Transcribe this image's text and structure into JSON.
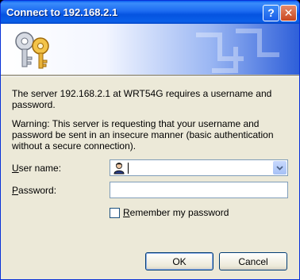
{
  "window": {
    "title": "Connect to 192.168.2.1",
    "help_label": "?",
    "close_label": "✕"
  },
  "messages": {
    "info": "The server 192.168.2.1 at WRT54G requires a username and password.",
    "warning": "Warning: This server is requesting that your username and password be sent in an insecure manner (basic authentication without a secure connection)."
  },
  "form": {
    "username": {
      "accel": "U",
      "rest": "ser name:",
      "value": ""
    },
    "password": {
      "accel": "P",
      "rest": "assword:",
      "value": ""
    },
    "remember": {
      "accel": "R",
      "rest": "emember my password",
      "checked": false
    }
  },
  "buttons": {
    "ok": "OK",
    "cancel": "Cancel"
  },
  "icons": {
    "banner": "keys-icon",
    "user": "user-icon",
    "dropdown": "chevron-down-icon"
  },
  "colors": {
    "titlebar": "#0a5ff0",
    "dialog_bg": "#ece9d8",
    "field_border": "#7f9db9"
  }
}
